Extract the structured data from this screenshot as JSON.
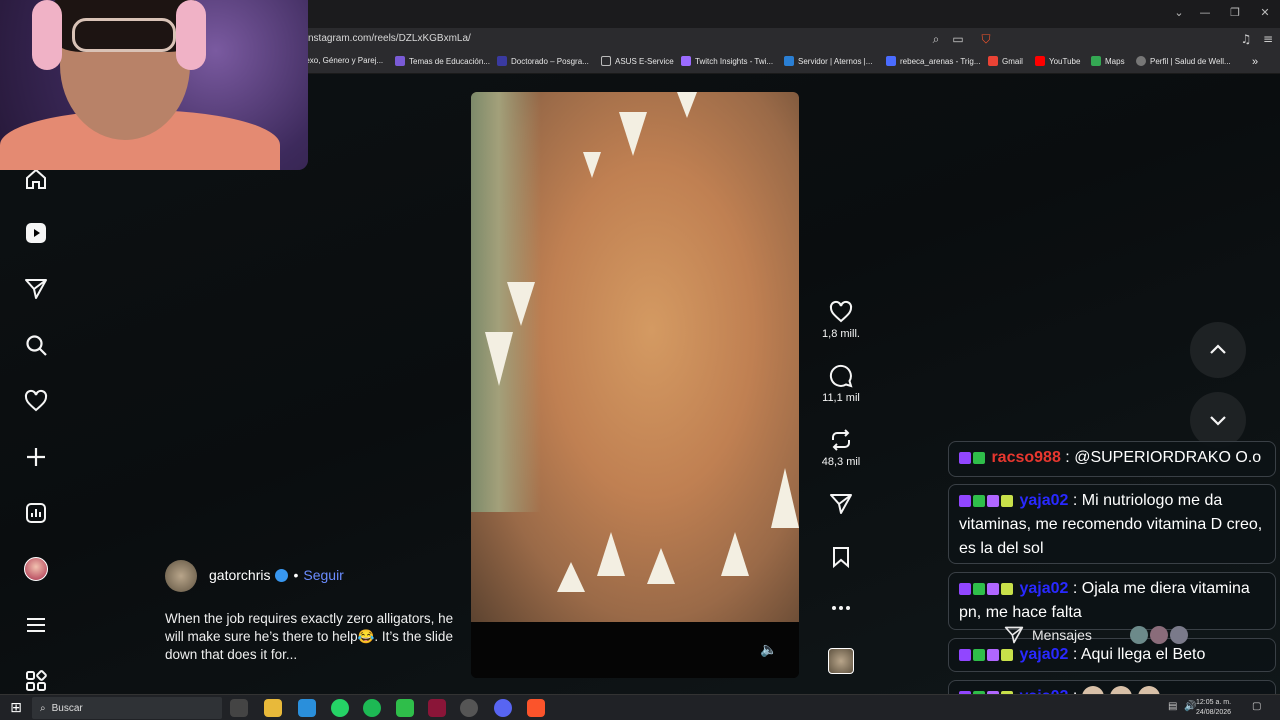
{
  "browser": {
    "url": "nstagram.com/reels/DZLxKGBxmLa/",
    "window_controls": [
      "⌄",
      "—",
      "❐",
      "✕"
    ],
    "bookmarks": [
      {
        "label": "Sexo, Género y Parej...",
        "color": "#555555"
      },
      {
        "label": "Temas de Educación...",
        "color": "#7a5bd6"
      },
      {
        "label": "Doctorado – Posgra...",
        "color": "#3a3aa0"
      },
      {
        "label": "ASUS E-Service",
        "color": "#888888"
      },
      {
        "label": "Twitch Insights - Twi...",
        "color": "#9b6bff"
      },
      {
        "label": "Servidor | Aternos |...",
        "color": "#2a7fd4"
      },
      {
        "label": "rebeca_arenas - Trig...",
        "color": "#4a6cff"
      },
      {
        "label": "Gmail",
        "color": "#ea4335"
      },
      {
        "label": "YouTube",
        "color": "#ff0000"
      },
      {
        "label": "Maps",
        "color": "#34a853"
      },
      {
        "label": "Perfil | Salud de Well...",
        "color": "#777777"
      }
    ]
  },
  "nav": {
    "items": [
      "home-icon",
      "reels-icon",
      "send-icon",
      "search-icon",
      "heart-icon",
      "create-icon",
      "insights-icon",
      "profile-avatar",
      "menu-icon",
      "apps-icon"
    ]
  },
  "reel": {
    "author": "gatorchris",
    "separator": "•",
    "follow_label": "Seguir",
    "caption": "When the job requires exactly zero alligators, he will make sure he’s there to help😂. It’s the slide down that does it for...",
    "likes": "1,8 mill.",
    "comments": "11,1 mil",
    "reposts": "48,3 mil",
    "mute_icon": "🔈"
  },
  "chat": [
    {
      "user": "racso988",
      "user_color": "#e8372f",
      "badges": [
        "#9146ff",
        "#2fbe4a"
      ],
      "text": "@SUPERIORDRAKO O.o"
    },
    {
      "user": "yaja02",
      "user_color": "#2929ff",
      "badges": [
        "#9146ff",
        "#2fbe4a",
        "#b066ff",
        "#c8e04a"
      ],
      "text": "Mi nutriologo me da vitaminas, me recomendo vitamina D creo, es la del sol"
    },
    {
      "user": "yaja02",
      "user_color": "#2929ff",
      "badges": [
        "#9146ff",
        "#2fbe4a",
        "#b066ff",
        "#c8e04a"
      ],
      "text": "Ojala me diera vitamina pn, me hace falta"
    },
    {
      "user": "yaja02",
      "user_color": "#2929ff",
      "badges": [
        "#9146ff",
        "#2fbe4a",
        "#b066ff",
        "#c8e04a"
      ],
      "text": "Aqui llega el Beto"
    },
    {
      "user": "yaja02",
      "user_color": "#2929ff",
      "badges": [
        "#9146ff",
        "#2fbe4a",
        "#b066ff",
        "#c8e04a"
      ],
      "text": ""
    }
  ],
  "messages_label": "Mensajes",
  "taskbar": {
    "search_placeholder": "Buscar",
    "time": "12:05 a. m.",
    "date": "24/08/2026"
  }
}
